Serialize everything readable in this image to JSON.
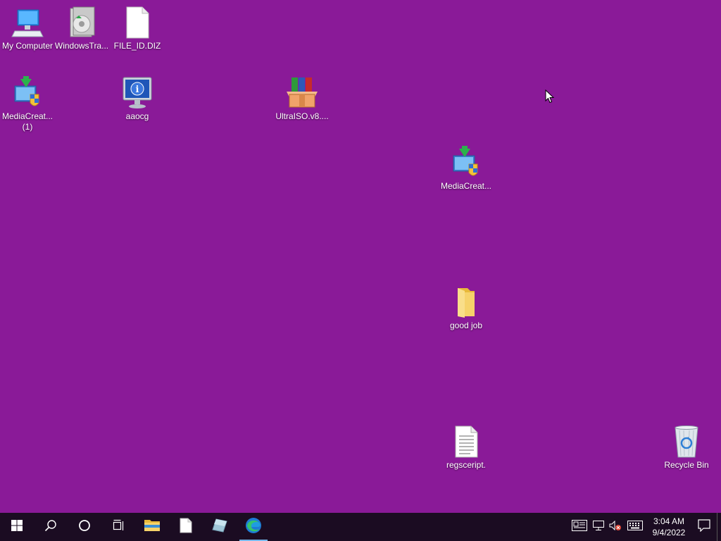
{
  "desktop": {
    "background": "#8a1a98",
    "icons": [
      {
        "label": "My Computer",
        "icon": "computer-icon"
      },
      {
        "label": "WindowsTra...",
        "icon": "installer-disc-icon"
      },
      {
        "label": "FILE_ID.DIZ",
        "icon": "blank-file-icon"
      },
      {
        "label": "MediaCreat...\n(1)",
        "icon": "media-creation-tool-icon"
      },
      {
        "label": "aaocg",
        "icon": "info-monitor-icon"
      },
      {
        "label": "UltraISO.v8....",
        "icon": "winrar-archive-icon"
      },
      {
        "label": "MediaCreat...",
        "icon": "media-creation-tool-icon"
      },
      {
        "label": "good job",
        "icon": "folder-icon"
      },
      {
        "label": "regsceript.",
        "icon": "text-file-icon"
      },
      {
        "label": "Recycle Bin",
        "icon": "recycle-bin-icon"
      }
    ]
  },
  "taskbar": {
    "background": "#1b0c22",
    "buttons": [
      {
        "name": "start",
        "icon": "windows-logo-icon"
      },
      {
        "name": "search",
        "icon": "search-icon"
      },
      {
        "name": "cortana",
        "icon": "cortana-circle-icon"
      },
      {
        "name": "task-view",
        "icon": "task-view-icon"
      },
      {
        "name": "file-explorer",
        "icon": "folder-icon"
      },
      {
        "name": "notepad",
        "icon": "blank-file-icon"
      },
      {
        "name": "app",
        "icon": "glass-app-icon"
      },
      {
        "name": "edge",
        "icon": "edge-browser-icon",
        "active": true
      }
    ],
    "tray": {
      "icons": [
        "news-widget-icon",
        "network-icon",
        "volume-muted-icon",
        "keyboard-icon"
      ],
      "time": "3:04 AM",
      "date": "9/4/2022",
      "notification_icon": "notification-icon"
    }
  }
}
